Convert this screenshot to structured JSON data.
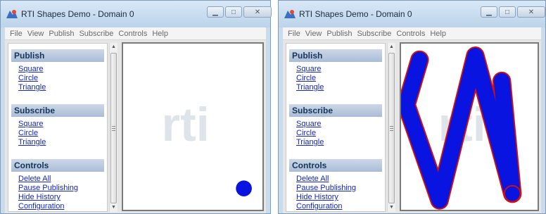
{
  "windows": [
    {
      "id": "left",
      "title": "RTI Shapes Demo - Domain 0",
      "menu": [
        "File",
        "View",
        "Publish",
        "Subscribe",
        "Controls",
        "Help"
      ],
      "sections": {
        "publish": {
          "title": "Publish",
          "items": [
            "Square",
            "Circle",
            "Triangle"
          ]
        },
        "subscribe": {
          "title": "Subscribe",
          "items": [
            "Square",
            "Circle",
            "Triangle"
          ]
        },
        "controls": {
          "title": "Controls",
          "items": [
            "Delete All",
            "Pause Publishing",
            "Hide History",
            "Configuration"
          ]
        }
      },
      "watermark": "rti",
      "shape_color": "#0a14e0"
    },
    {
      "id": "right",
      "title": "RTI Shapes Demo - Domain 0",
      "menu": [
        "File",
        "View",
        "Publish",
        "Subscribe",
        "Controls",
        "Help"
      ],
      "sections": {
        "publish": {
          "title": "Publish",
          "items": [
            "Square",
            "Circle",
            "Triangle"
          ]
        },
        "subscribe": {
          "title": "Subscribe",
          "items": [
            "Square",
            "Circle",
            "Triangle"
          ]
        },
        "controls": {
          "title": "Controls",
          "items": [
            "Delete All",
            "Pause Publishing",
            "Hide History",
            "Configuration"
          ]
        }
      },
      "watermark": "rti",
      "shape_color": "#0a14e0",
      "history_outline_color": "#d01010"
    }
  ]
}
